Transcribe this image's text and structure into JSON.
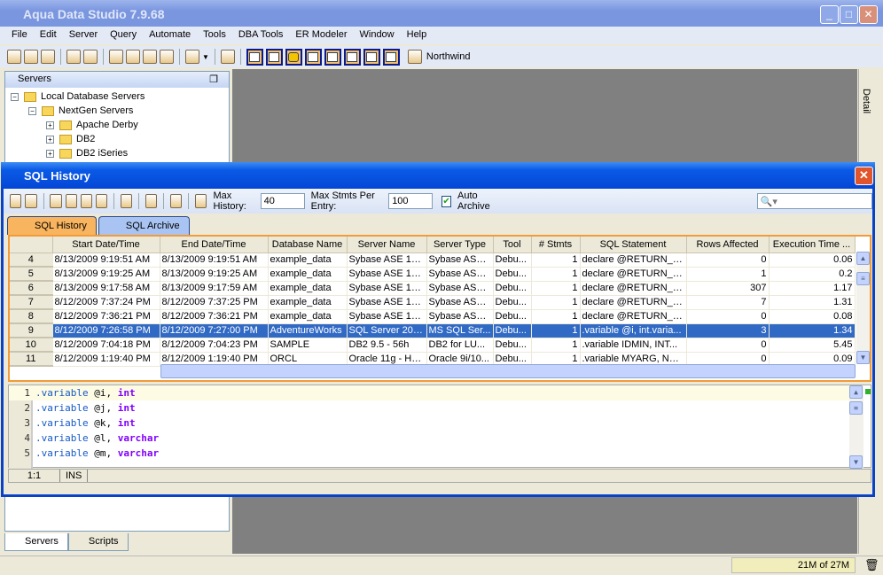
{
  "app": {
    "title": "Aqua Data Studio 7.9.68"
  },
  "menu": [
    "File",
    "Edit",
    "Server",
    "Query",
    "Automate",
    "Tools",
    "DBA Tools",
    "ER Modeler",
    "Window",
    "Help"
  ],
  "toolbar": {
    "connection": "Northwind"
  },
  "servers_panel": {
    "title": "Servers",
    "tree": [
      {
        "label": "Local Database Servers",
        "level": 0,
        "expanded": true
      },
      {
        "label": "NextGen Servers",
        "level": 1,
        "expanded": true
      },
      {
        "label": "Apache Derby",
        "level": 2,
        "expanded": false
      },
      {
        "label": "DB2",
        "level": 2,
        "expanded": false
      },
      {
        "label": "DB2 iSeries",
        "level": 2,
        "expanded": false
      }
    ]
  },
  "bottom_tabs": [
    "Servers",
    "Scripts"
  ],
  "detail_label": "Detail",
  "status": {
    "memory": "21M of 27M"
  },
  "sql_history": {
    "title": "SQL History",
    "max_history_label": "Max History:",
    "max_history": "40",
    "max_stmts_label": "Max Stmts Per Entry:",
    "max_stmts": "100",
    "auto_archive_label": "Auto Archive",
    "auto_archive": true,
    "tabs": [
      "SQL History",
      "SQL Archive"
    ],
    "columns": [
      "Start Date/Time",
      "End Date/Time",
      "Database Name",
      "Server Name",
      "Server Type",
      "Tool",
      "# Stmts",
      "SQL Statement",
      "Rows Affected",
      "Execution Time ..."
    ],
    "rows": [
      [
        "4",
        "8/13/2009 9:19:51 AM",
        "8/13/2009 9:19:51 AM",
        "example_data",
        "Sybase ASE 15....",
        "Sybase ASE...",
        "Debu...",
        "1",
        "declare @RETURN_V...",
        "0",
        "0.06"
      ],
      [
        "5",
        "8/13/2009 9:19:25 AM",
        "8/13/2009 9:19:25 AM",
        "example_data",
        "Sybase ASE 15....",
        "Sybase ASE...",
        "Debu...",
        "1",
        "declare @RETURN_V...",
        "1",
        "0.2"
      ],
      [
        "6",
        "8/13/2009 9:17:58 AM",
        "8/13/2009 9:17:59 AM",
        "example_data",
        "Sybase ASE 15....",
        "Sybase ASE...",
        "Debu...",
        "1",
        "declare @RETURN_V...",
        "307",
        "1.17"
      ],
      [
        "7",
        "8/12/2009 7:37:24 PM",
        "8/12/2009 7:37:25 PM",
        "example_data",
        "Sybase ASE 15....",
        "Sybase ASE...",
        "Debu...",
        "1",
        "declare @RETURN_V...",
        "7",
        "1.31"
      ],
      [
        "8",
        "8/12/2009 7:36:21 PM",
        "8/12/2009 7:36:21 PM",
        "example_data",
        "Sybase ASE 15....",
        "Sybase ASE...",
        "Debu...",
        "1",
        "declare @RETURN_V...",
        "0",
        "0.08"
      ],
      [
        "9",
        "8/12/2009 7:26:58 PM",
        "8/12/2009 7:27:00 PM",
        "AdventureWorks",
        "SQL Server 200...",
        "MS SQL Ser...",
        "Debu...",
        "1",
        ".variable @i, int.varia...",
        "3",
        "1.34"
      ],
      [
        "10",
        "8/12/2009 7:04:18 PM",
        "8/12/2009 7:04:23 PM",
        "SAMPLE",
        "DB2 9.5 - 56h",
        "DB2 for LU...",
        "Debu...",
        "1",
        ".variable IDMIN, INT...",
        "0",
        "5.45"
      ],
      [
        "11",
        "8/12/2009 1:19:40 PM",
        "8/12/2009 1:19:40 PM",
        "ORCL",
        "Oracle 11g - HR...",
        "Oracle 9i/10...",
        "Debu...",
        "1",
        ".variable MYARG, NU...",
        "0",
        "0.09"
      ]
    ],
    "selected_row": "9",
    "editor_lines": [
      {
        "n": "1",
        "kw": ".variable",
        "var": "@i,",
        "type": "int"
      },
      {
        "n": "2",
        "kw": ".variable",
        "var": "@j,",
        "type": "int"
      },
      {
        "n": "3",
        "kw": ".variable",
        "var": "@k,",
        "type": "int"
      },
      {
        "n": "4",
        "kw": ".variable",
        "var": "@l,",
        "type": "varchar"
      },
      {
        "n": "5",
        "kw": ".variable",
        "var": "@m,",
        "type": "varchar"
      }
    ],
    "cursor": "1:1",
    "mode": "INS"
  }
}
